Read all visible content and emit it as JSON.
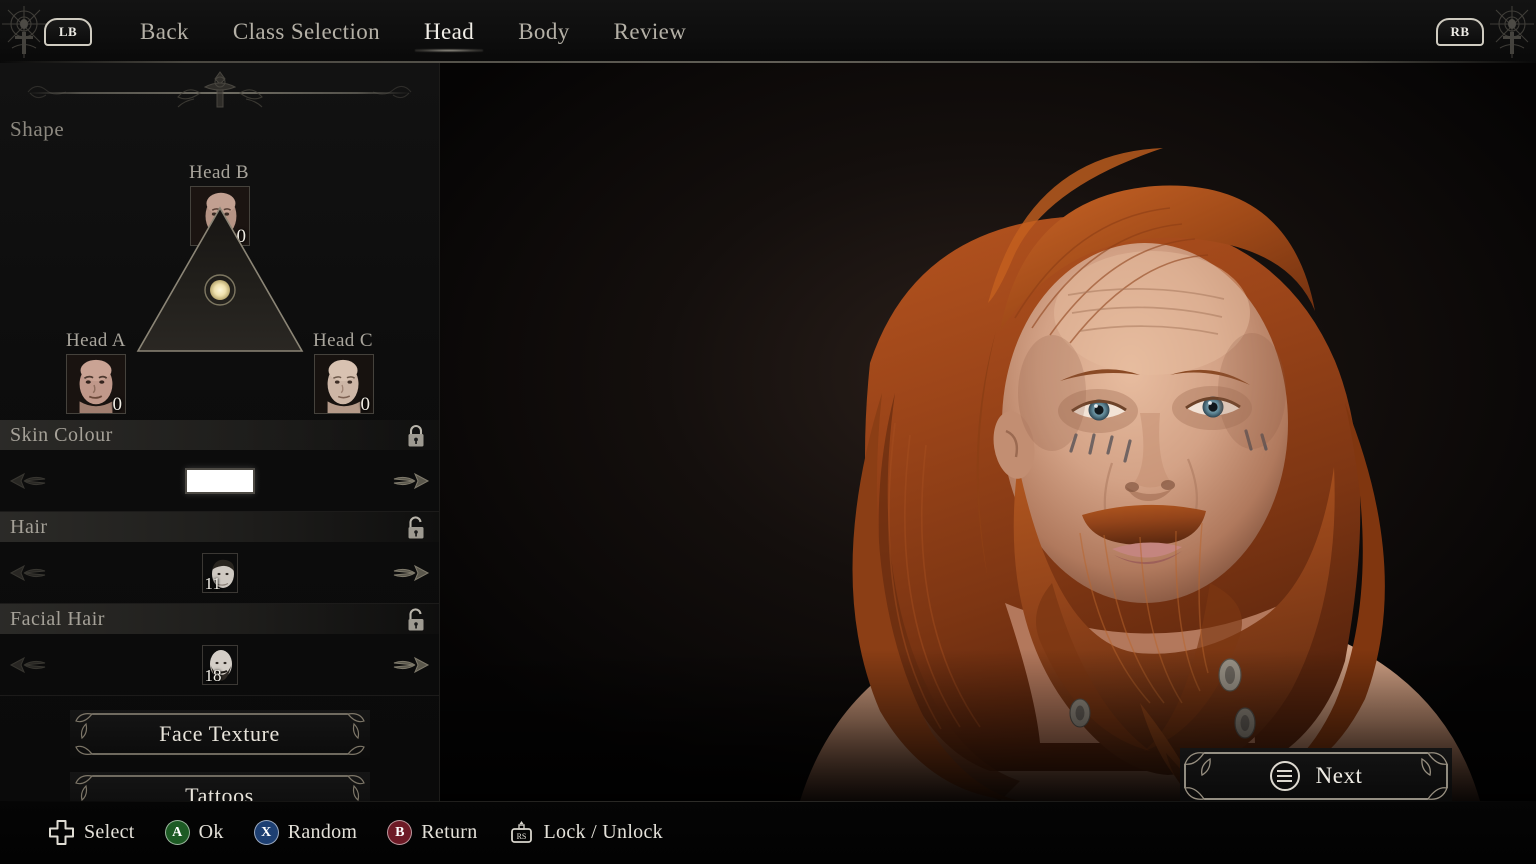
{
  "topnav": {
    "bumper_left": "LB",
    "bumper_right": "RB",
    "tabs": [
      {
        "label": "Back",
        "active": false
      },
      {
        "label": "Class Selection",
        "active": false
      },
      {
        "label": "Head",
        "active": true
      },
      {
        "label": "Body",
        "active": false
      },
      {
        "label": "Review",
        "active": false
      }
    ]
  },
  "left_panel": {
    "section_title": "Shape",
    "shape": {
      "head_b": {
        "label": "Head B",
        "value": "0"
      },
      "head_a": {
        "label": "Head A",
        "value": "0"
      },
      "head_c": {
        "label": "Head C",
        "value": "0"
      },
      "blend_marker_color": "#f2e8c4"
    },
    "rows": [
      {
        "label": "Skin Colour",
        "lock_state": "locked",
        "lock_icon": "padlock-closed-icon",
        "control": "colour-swatch",
        "swatch_color": "#ffffff",
        "value": ""
      },
      {
        "label": "Hair",
        "lock_state": "unlocked",
        "lock_icon": "padlock-open-icon",
        "control": "option-thumb",
        "value": "11"
      },
      {
        "label": "Facial Hair",
        "lock_state": "unlocked",
        "lock_icon": "padlock-open-icon",
        "control": "option-thumb",
        "value": "18"
      }
    ],
    "buttons": [
      {
        "label": "Face Texture"
      },
      {
        "label": "Tattoos"
      }
    ]
  },
  "viewport": {
    "next_button": {
      "label": "Next",
      "icon": "menu-circle-icon"
    }
  },
  "bottombar": {
    "hints": [
      {
        "icon": "dpad-icon",
        "label": "Select"
      },
      {
        "icon": "button-a-icon",
        "glyph": "A",
        "label": "Ok",
        "color": "#1d5b24"
      },
      {
        "icon": "button-x-icon",
        "glyph": "X",
        "label": "Random",
        "color": "#1d3f72"
      },
      {
        "icon": "button-b-icon",
        "glyph": "B",
        "label": "Return",
        "color": "#6d1a26"
      },
      {
        "icon": "right-stick-icon",
        "glyph": "RS",
        "label": "Lock / Unlock"
      }
    ]
  }
}
